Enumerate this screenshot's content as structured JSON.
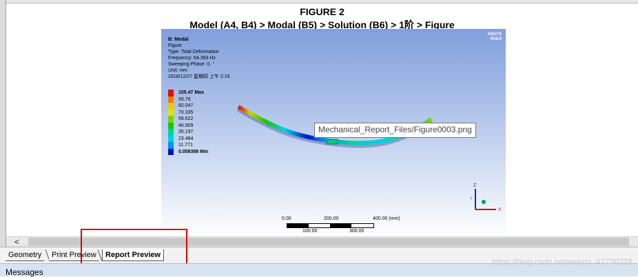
{
  "figure": {
    "title": "FIGURE 2",
    "subtitle": "Model (A4, B4) > Modal (B5) > Solution (B6) > 1阶  > Figure",
    "info_lines": [
      "B: Modal",
      "Figure",
      "Type: Total Deformation",
      "Frequency: 64.393 Hz",
      "Sweeping Phase: 0. °",
      "Unit: mm",
      "2018/12/27 星期四 上午 2:16"
    ],
    "brand": "ANSYS",
    "brand_sub": "R19.0",
    "legend": [
      {
        "label": "105.47 Max",
        "color": "#e01010",
        "bold": true
      },
      {
        "label": "93.76",
        "color": "#f07a00"
      },
      {
        "label": "82.047",
        "color": "#f0c800"
      },
      {
        "label": "70.335",
        "color": "#d8e800"
      },
      {
        "label": "58.622",
        "color": "#7ad400"
      },
      {
        "label": "46.909",
        "color": "#12c800"
      },
      {
        "label": "35.197",
        "color": "#00d49a"
      },
      {
        "label": "23.484",
        "color": "#00d0e8"
      },
      {
        "label": "11.771",
        "color": "#0090f0"
      },
      {
        "label": "0.058398 Min",
        "color": "#0012c8",
        "bold": true
      }
    ],
    "scale": {
      "top_labels": [
        "0.00",
        "200.00",
        "400.00 (mm)"
      ],
      "bottom_labels": [
        "100.00",
        "300.00"
      ]
    },
    "triad": {
      "z": "Z",
      "y": "Y",
      "x": "X"
    }
  },
  "tooltip": "Mechanical_Report_Files/Figure0003.png",
  "tabs": [
    {
      "label": "Geometry",
      "active": false
    },
    {
      "label": "Print Preview",
      "active": false
    },
    {
      "label": "Report Preview",
      "active": true
    }
  ],
  "scroll_arrow": "<",
  "messages_label": "Messages",
  "watermark": "https://blog.csdn.net/weixin_43730228"
}
